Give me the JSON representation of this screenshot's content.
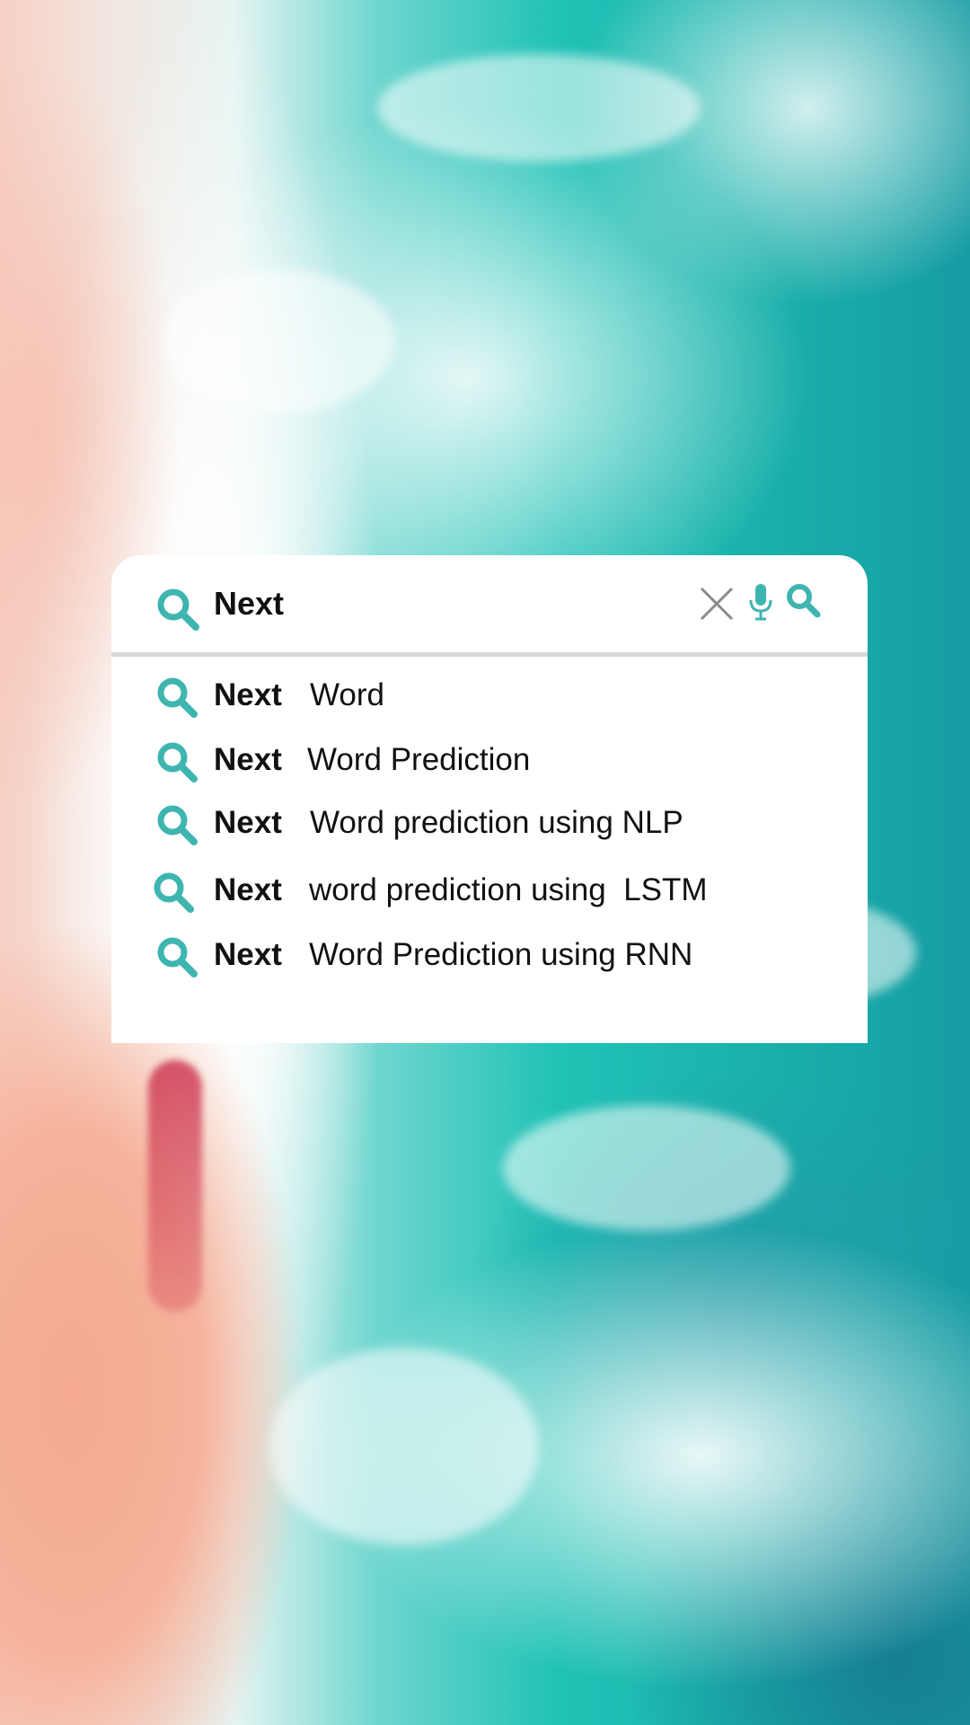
{
  "search": {
    "query": "Next",
    "accent_color": "#3fb5b0",
    "icons": [
      "search-icon",
      "close-icon",
      "microphone-icon",
      "search-icon"
    ]
  },
  "suggestions": [
    {
      "bold": "Next",
      "rest": "Word"
    },
    {
      "bold": "Next",
      "rest": "Word Prediction"
    },
    {
      "bold": "Next",
      "rest": "Word prediction using NLP"
    },
    {
      "bold": "Next",
      "rest": "word prediction using  LSTM"
    },
    {
      "bold": "Next",
      "rest": "Word Prediction using RNN"
    }
  ]
}
